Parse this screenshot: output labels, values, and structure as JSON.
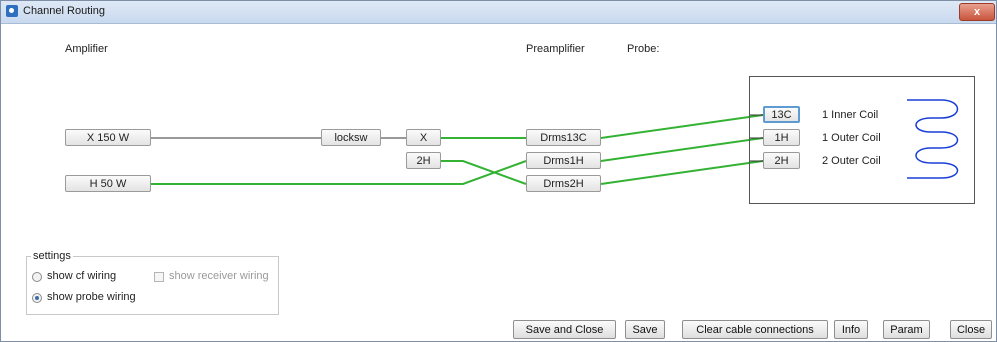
{
  "window": {
    "title": "Channel Routing",
    "close_glyph": "x"
  },
  "headers": {
    "amplifier": "Amplifier",
    "preamplifier": "Preamplifier",
    "probe": "Probe:"
  },
  "amplifiers": [
    "X 150 W",
    "H 50 W"
  ],
  "locksw": "locksw",
  "nuclei": [
    "X",
    "2H"
  ],
  "preamps": [
    "Drms13C",
    "Drms1H",
    "Drms2H"
  ],
  "probe_channels": [
    "13C",
    "1H",
    "2H"
  ],
  "coils": [
    "1 Inner Coil",
    "1 Outer Coil",
    "2 Outer Coil"
  ],
  "settings": {
    "title": "settings",
    "cf_wiring": "show cf wiring",
    "receiver_wiring": "show receiver wiring",
    "probe_wiring": "show probe wiring",
    "selected": "show probe wiring"
  },
  "buttons": {
    "save_and_close": "Save and Close",
    "save": "Save",
    "clear": "Clear cable connections",
    "info": "Info",
    "param": "Param",
    "close": "Close"
  },
  "colors": {
    "wire_active": "#33b233",
    "wire_idle": "#333333",
    "coil": "#1a3fd6"
  }
}
